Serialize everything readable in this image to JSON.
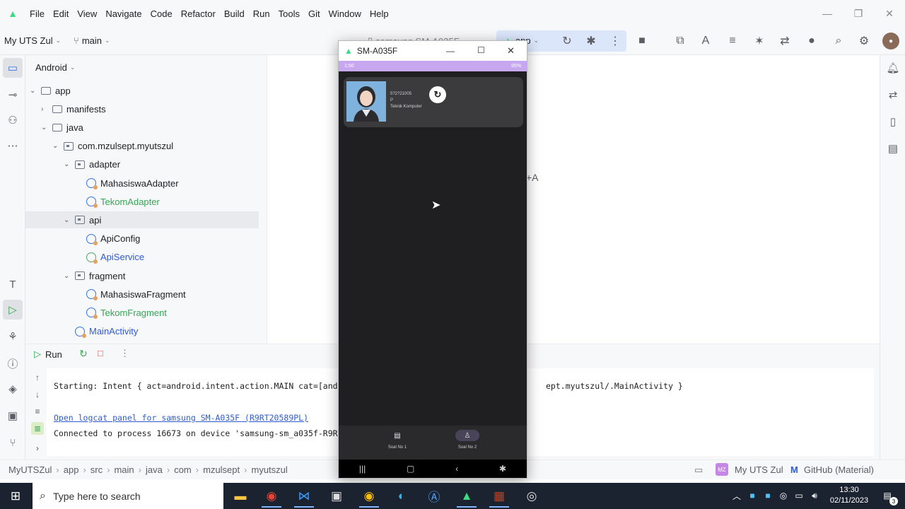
{
  "menubar": {
    "items": [
      "File",
      "Edit",
      "View",
      "Navigate",
      "Code",
      "Refactor",
      "Build",
      "Run",
      "Tools",
      "Git",
      "Window",
      "Help"
    ]
  },
  "toolbar": {
    "project_name": "My UTS Zul",
    "branch": "main",
    "device": "samsung SM-A035F",
    "run_config": "app"
  },
  "project_panel": {
    "view_mode": "Android",
    "tree": [
      {
        "label": "app",
        "indent": 0,
        "expanded": true,
        "kind": "module"
      },
      {
        "label": "manifests",
        "indent": 1,
        "expanded": false,
        "kind": "folder"
      },
      {
        "label": "java",
        "indent": 1,
        "expanded": true,
        "kind": "folder"
      },
      {
        "label": "com.mzulsept.myutszul",
        "indent": 2,
        "expanded": true,
        "kind": "package"
      },
      {
        "label": "adapter",
        "indent": 3,
        "expanded": true,
        "kind": "package"
      },
      {
        "label": "MahasiswaAdapter",
        "indent": 4,
        "kind": "class"
      },
      {
        "label": "TekomAdapter",
        "indent": 4,
        "kind": "class",
        "color": "green"
      },
      {
        "label": "api",
        "indent": 3,
        "expanded": true,
        "kind": "package",
        "selected": true
      },
      {
        "label": "ApiConfig",
        "indent": 4,
        "kind": "class"
      },
      {
        "label": "ApiService",
        "indent": 4,
        "kind": "interface",
        "color": "blue"
      },
      {
        "label": "fragment",
        "indent": 3,
        "expanded": true,
        "kind": "package"
      },
      {
        "label": "MahasiswaFragment",
        "indent": 4,
        "kind": "class"
      },
      {
        "label": "TekomFragment",
        "indent": 4,
        "kind": "class",
        "color": "green"
      },
      {
        "label": "MainActivity",
        "indent": 3,
        "kind": "class",
        "color": "blue"
      }
    ]
  },
  "editor": {
    "fragment_text": "+A"
  },
  "run_panel": {
    "tab_label": "Run",
    "lines": [
      "Starting: Intent { act=android.intent.action.MAIN cat=[androi",
      "ept.myutszul/.MainActivity }",
      "Open logcat panel for samsung SM-A035F (R9RT20589PL)",
      "Connected to process 16673 on device 'samsung-sm_a035f-R9RT20"
    ]
  },
  "statusbar": {
    "breadcrumbs": [
      "MyUTSZul",
      "app",
      "src",
      "main",
      "java",
      "com",
      "mzulsept",
      "myutszul"
    ],
    "project_badge": "MZ",
    "project_name": "My UTS Zul",
    "theme": "GitHub (Material)"
  },
  "emulator": {
    "title": "SM-A035F",
    "status_left": "1:50",
    "status_right": "95%",
    "card": {
      "nim": "5?2?21005",
      "gender": "P",
      "prodi": "Teknik Komputer"
    },
    "bottom_nav": [
      {
        "label": "Soal No 1",
        "icon": "table-icon",
        "active": false
      },
      {
        "label": "Soal No 2",
        "icon": "person-icon",
        "active": true
      }
    ]
  },
  "taskbar": {
    "search_placeholder": "Type here to search",
    "time": "13:30",
    "date": "02/11/2023",
    "notification_count": "3"
  },
  "colors": {
    "accent": "#3574f0",
    "android_green": "#3ddc84",
    "status_bar_purple": "#c7a7f0",
    "taskbar": "#1c2330"
  }
}
